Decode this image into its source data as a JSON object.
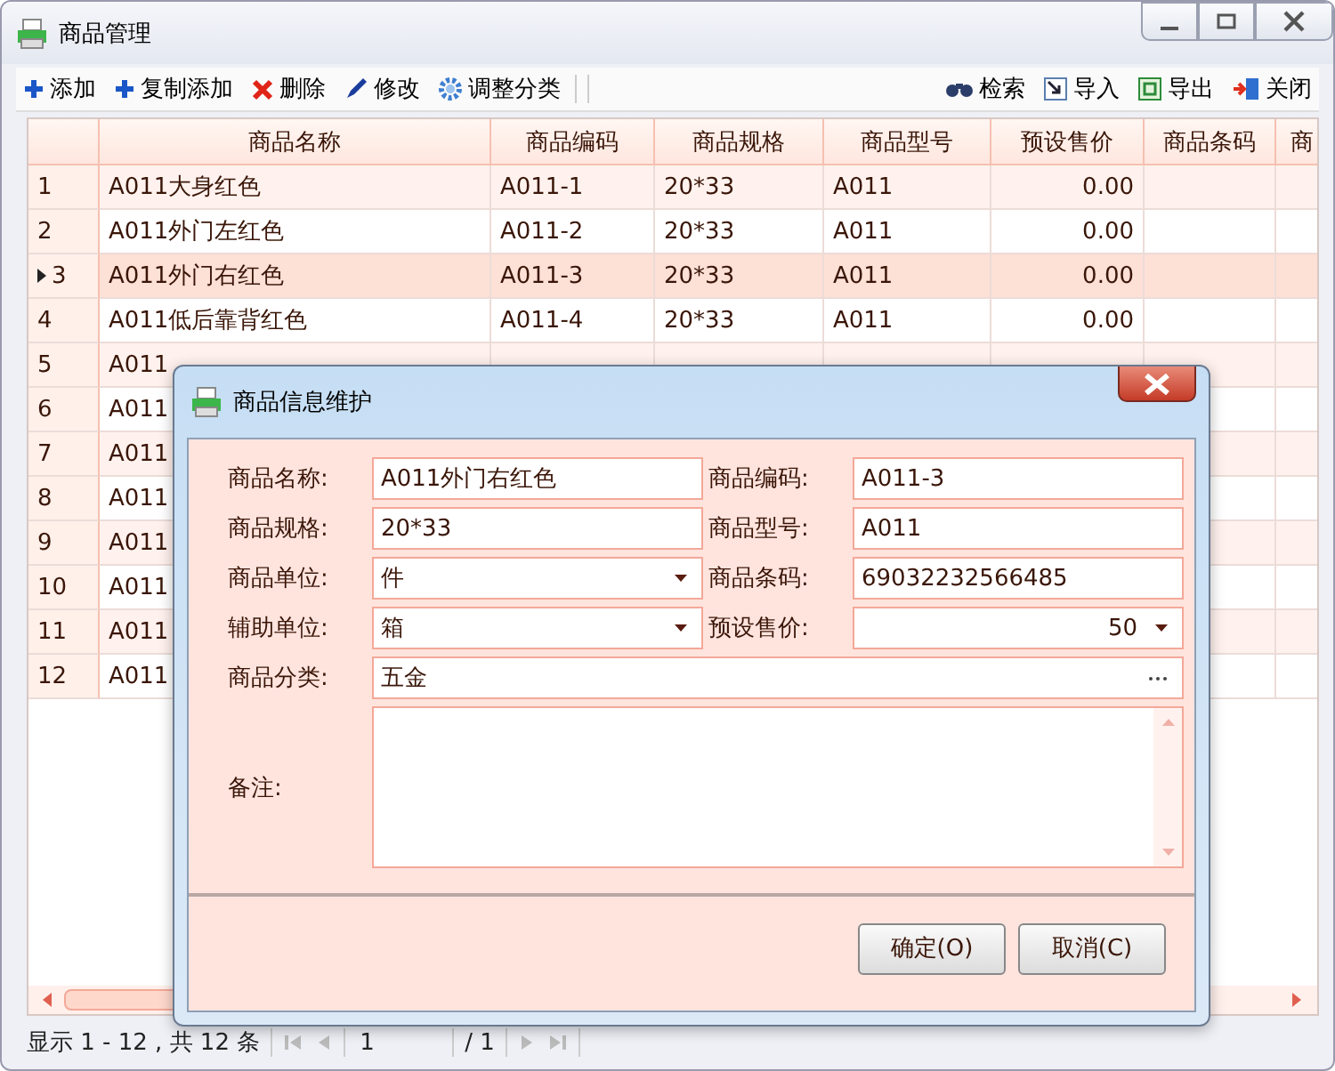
{
  "window": {
    "title": "商品管理"
  },
  "toolbar": {
    "left_items": [
      "添加",
      "复制添加",
      "删除",
      "修改",
      "调整分类"
    ],
    "right_items": [
      "检索",
      "导入",
      "导出",
      "关闭"
    ]
  },
  "table": {
    "columns": [
      "商品名称",
      "商品编码",
      "商品规格",
      "商品型号",
      "预设售价",
      "商品条码",
      "商"
    ],
    "rows": [
      {
        "num": "1",
        "name": "A011大身红色",
        "code": "A011-1",
        "spec": "20*33",
        "model": "A011",
        "price": "0.00",
        "selected": false
      },
      {
        "num": "2",
        "name": "A011外门左红色",
        "code": "A011-2",
        "spec": "20*33",
        "model": "A011",
        "price": "0.00",
        "selected": false
      },
      {
        "num": "3",
        "name": "A011外门右红色",
        "code": "A011-3",
        "spec": "20*33",
        "model": "A011",
        "price": "0.00",
        "selected": true
      },
      {
        "num": "4",
        "name": "A011低后靠背红色",
        "code": "A011-4",
        "spec": "20*33",
        "model": "A011",
        "price": "0.00",
        "selected": false
      },
      {
        "num": "5",
        "name": "A011",
        "selected": false
      },
      {
        "num": "6",
        "name": "A011",
        "selected": false
      },
      {
        "num": "7",
        "name": "A011",
        "selected": false
      },
      {
        "num": "8",
        "name": "A011",
        "selected": false
      },
      {
        "num": "9",
        "name": "A011",
        "selected": false
      },
      {
        "num": "10",
        "name": "A011",
        "selected": false
      },
      {
        "num": "11",
        "name": "A011",
        "selected": false
      },
      {
        "num": "12",
        "name": "A011",
        "selected": false
      }
    ]
  },
  "status_bar": {
    "summary": "显示 1 - 12 , 共 12 条",
    "page": "1",
    "total_pages": "/ 1"
  },
  "dialog": {
    "title": "商品信息维护",
    "fields": [
      {
        "label": "商品名称:",
        "value": "A011外门右红色",
        "kind": "text"
      },
      {
        "label": "商品编码:",
        "value": "A011-3",
        "kind": "text"
      },
      {
        "label": "商品规格:",
        "value": "20*33",
        "kind": "text"
      },
      {
        "label": "商品型号:",
        "value": "A011",
        "kind": "text"
      },
      {
        "label": "商品单位:",
        "value": "件",
        "kind": "combo"
      },
      {
        "label": "商品条码:",
        "value": "69032232566485",
        "kind": "text"
      },
      {
        "label": "辅助单位:",
        "value": "箱",
        "kind": "combo"
      },
      {
        "label": "预设售价:",
        "value": "50",
        "kind": "spin"
      },
      {
        "label": "商品分类:",
        "value": "五金",
        "kind": "picker"
      },
      {
        "label": "备注:",
        "kind": "memo"
      }
    ],
    "buttons": [
      "确定(O)",
      "取消(C)"
    ]
  }
}
